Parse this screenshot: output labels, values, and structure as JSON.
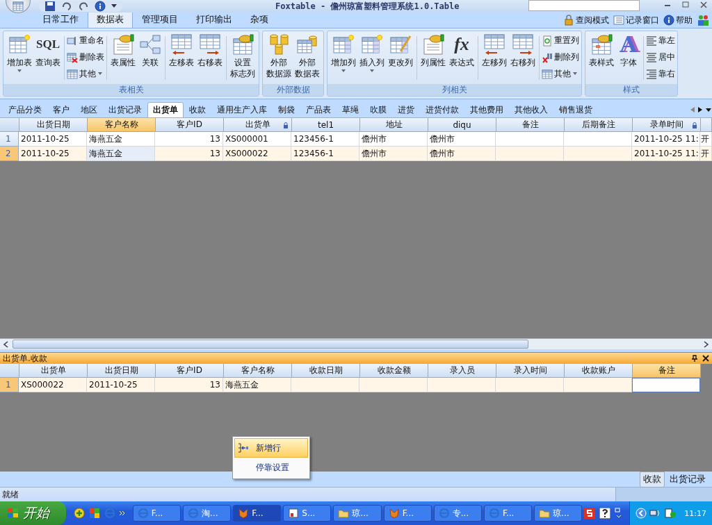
{
  "window": {
    "title": "Foxtable - 儋州琼富塑料管理系统1.0.Table"
  },
  "ribbon": {
    "tabs": [
      {
        "label": "日常工作",
        "selected": false
      },
      {
        "label": "数据表",
        "selected": true
      },
      {
        "label": "管理项目",
        "selected": false
      },
      {
        "label": "打印输出",
        "selected": false
      },
      {
        "label": "杂项",
        "selected": false
      }
    ],
    "links": [
      {
        "label": "查阅模式"
      },
      {
        "label": "记录窗口"
      },
      {
        "label": "帮助"
      }
    ],
    "groups": [
      {
        "label": "表相关",
        "items": [
          {
            "kind": "large",
            "label": [
              "增加表"
            ],
            "dropdown": true
          },
          {
            "kind": "large",
            "label": [
              "查询表"
            ],
            "icon_text": "SQL"
          },
          {
            "kind": "separator"
          },
          {
            "kind": "stack",
            "buttons": [
              {
                "label": "重命名"
              },
              {
                "label": "删除表"
              },
              {
                "label": "其他",
                "dropdown": true
              }
            ]
          },
          {
            "kind": "separator"
          },
          {
            "kind": "large",
            "label": [
              "表属性"
            ]
          },
          {
            "kind": "large",
            "label": [
              "关联"
            ]
          },
          {
            "kind": "separator"
          },
          {
            "kind": "large",
            "label": [
              "左移表"
            ]
          },
          {
            "kind": "large",
            "label": [
              "右移表"
            ]
          },
          {
            "kind": "separator"
          },
          {
            "kind": "large",
            "label": [
              "设置",
              "标志列"
            ]
          }
        ]
      },
      {
        "label": "外部数据",
        "items": [
          {
            "kind": "large",
            "label": [
              "外部",
              "数据源"
            ]
          },
          {
            "kind": "large",
            "label": [
              "外部",
              "数据表"
            ]
          }
        ]
      },
      {
        "label": "列相关",
        "items": [
          {
            "kind": "large",
            "label": [
              "增加列"
            ],
            "dropdown": true
          },
          {
            "kind": "large",
            "label": [
              "插入列"
            ],
            "dropdown": true
          },
          {
            "kind": "large",
            "label": [
              "更改列"
            ]
          },
          {
            "kind": "separator"
          },
          {
            "kind": "large",
            "label": [
              "列属性"
            ]
          },
          {
            "kind": "large",
            "label": [
              "表达式"
            ],
            "icon_text": "fx"
          },
          {
            "kind": "separator"
          },
          {
            "kind": "large",
            "label": [
              "左移列"
            ]
          },
          {
            "kind": "large",
            "label": [
              "右移列"
            ]
          },
          {
            "kind": "separator"
          },
          {
            "kind": "stack",
            "buttons": [
              {
                "label": "重置列"
              },
              {
                "label": "删除列"
              },
              {
                "label": "其他",
                "dropdown": true
              }
            ]
          }
        ]
      },
      {
        "label": "样式",
        "items": [
          {
            "kind": "large",
            "label": [
              "表样式"
            ]
          },
          {
            "kind": "large",
            "label": [
              "字体"
            ],
            "icon_text": "A"
          },
          {
            "kind": "separator"
          },
          {
            "kind": "stack",
            "buttons": [
              {
                "label": "靠左"
              },
              {
                "label": "居中"
              },
              {
                "label": "靠右"
              }
            ]
          }
        ]
      }
    ]
  },
  "table_tabs": [
    {
      "label": "产品分类",
      "selected": false
    },
    {
      "label": "客户",
      "selected": false
    },
    {
      "label": "地区",
      "selected": false
    },
    {
      "label": "出货记录",
      "selected": false
    },
    {
      "label": "出货单",
      "selected": true
    },
    {
      "label": "收款",
      "selected": false
    },
    {
      "label": "通用生产入库",
      "selected": false
    },
    {
      "label": "制袋",
      "selected": false
    },
    {
      "label": "产品表",
      "selected": false
    },
    {
      "label": "草绳",
      "selected": false
    },
    {
      "label": "吹膜",
      "selected": false
    },
    {
      "label": "进货",
      "selected": false
    },
    {
      "label": "进货付款",
      "selected": false
    },
    {
      "label": "其他费用",
      "selected": false
    },
    {
      "label": "其他收入",
      "selected": false
    },
    {
      "label": "销售退货",
      "selected": false
    }
  ],
  "main_table": {
    "columns": [
      {
        "label": "出货日期",
        "selected": false
      },
      {
        "label": "客户名称",
        "selected": true
      },
      {
        "label": "客户ID",
        "selected": false,
        "numeric": true
      },
      {
        "label": "出货单",
        "selected": false,
        "locked": true
      },
      {
        "label": "tel1",
        "selected": false
      },
      {
        "label": "地址",
        "selected": false
      },
      {
        "label": "diqu",
        "selected": false
      },
      {
        "label": "备注",
        "selected": false
      },
      {
        "label": "后期备注",
        "selected": false
      },
      {
        "label": "录单时间",
        "selected": false,
        "locked": true
      },
      {
        "selected": false
      }
    ],
    "rows": [
      {
        "number": "1",
        "selected": false,
        "cells": [
          "2011-10-25",
          "海燕五金",
          "13",
          "XS000001",
          "123456-1",
          "儋州市",
          "儋州市",
          null,
          null,
          "2011-10-25 11:",
          "开"
        ]
      },
      {
        "number": "2",
        "selected": true,
        "cells": [
          "2011-10-25",
          "海燕五金",
          "13",
          "XS000022",
          "123456-1",
          "儋州市",
          "儋州市",
          null,
          null,
          "2011-10-25 11:",
          "开"
        ]
      }
    ]
  },
  "sub_panel": {
    "title": "出货单.收款",
    "table": {
      "editing": true,
      "columns": [
        {
          "label": "出货单",
          "selected": false
        },
        {
          "label": "出货日期",
          "selected": false
        },
        {
          "label": "客户ID",
          "selected": false,
          "numeric": true
        },
        {
          "label": "客户名称",
          "selected": false
        },
        {
          "label": "收款日期",
          "selected": false
        },
        {
          "label": "收款金额",
          "selected": false
        },
        {
          "label": "录入员",
          "selected": false
        },
        {
          "label": "录入时间",
          "selected": false
        },
        {
          "label": "收款账户",
          "selected": false
        },
        {
          "label": "备注",
          "selected": true
        }
      ],
      "rows": [
        {
          "number": "1",
          "selected": true,
          "cells": [
            "XS000022",
            "2011-10-25",
            "13",
            "海燕五金",
            null,
            null,
            null,
            null,
            null,
            null
          ]
        }
      ]
    }
  },
  "context_menu": [
    {
      "label": "新增行",
      "selected": true,
      "icon": true
    },
    {
      "label": "停靠设置",
      "selected": false
    }
  ],
  "bottom_tabs": [
    {
      "label": "收款",
      "selected": true
    },
    {
      "label": "出货记录",
      "selected": false
    }
  ],
  "status_bar": "就绪",
  "taskbar": {
    "start": "开始",
    "tasks": [
      {
        "label": "F...",
        "selected": false
      },
      {
        "label": "淘...",
        "selected": false
      },
      {
        "label": "F...",
        "selected": true
      },
      {
        "label": "S...",
        "selected": false
      },
      {
        "label": "琼...",
        "selected": false
      },
      {
        "label": "F...",
        "selected": false
      },
      {
        "label": "专...",
        "selected": false
      },
      {
        "label": "F...",
        "selected": false
      },
      {
        "label": "琼...",
        "selected": false
      }
    ],
    "clock": "11:17"
  }
}
